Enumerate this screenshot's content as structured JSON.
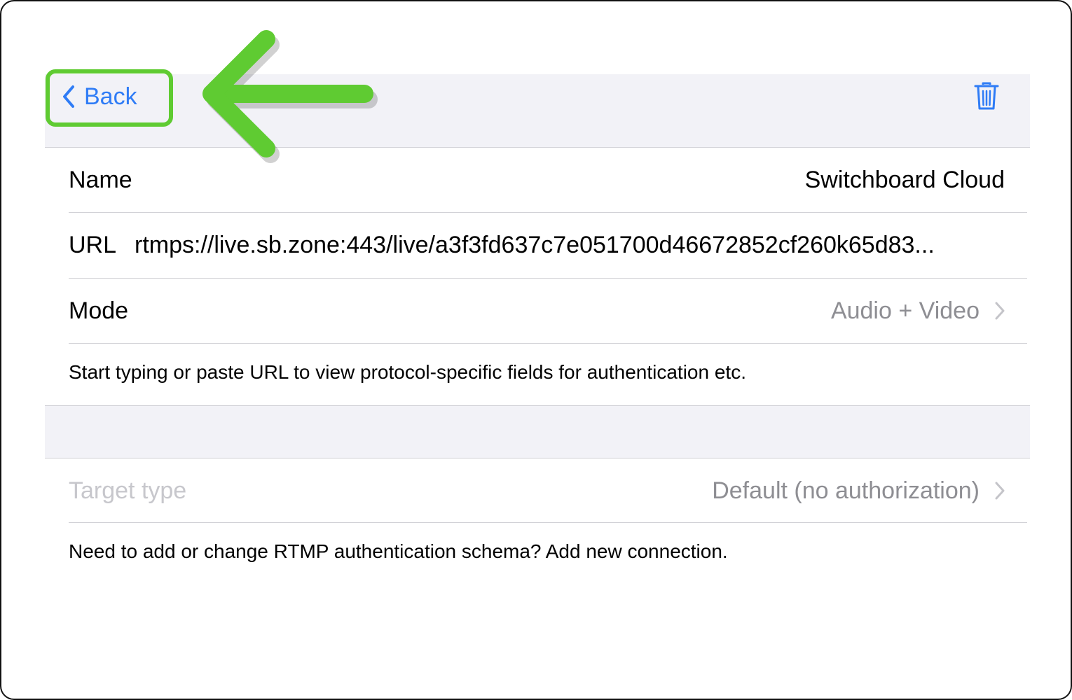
{
  "navbar": {
    "back_label": "Back",
    "back_icon": "chevron-left-icon",
    "delete_icon": "trash-icon"
  },
  "connection": {
    "name_label": "Name",
    "name_value": "Switchboard Cloud",
    "url_label": "URL",
    "url_value": "rtmps://live.sb.zone:443/live/a3f3fd637c7e051700d46672852cf260k65d83...",
    "mode_label": "Mode",
    "mode_value": "Audio + Video"
  },
  "hint_text": "Start typing or paste URL to view protocol-specific fields for authentication etc.",
  "target": {
    "label": "Target type",
    "value": "Default (no authorization)"
  },
  "footer_text": "Need to add or change RTMP authentication schema? Add new connection.",
  "colors": {
    "accent_blue": "#2f7cf6",
    "annotation_green": "#5fcb32",
    "secondary_gray": "#8e8e93",
    "grouped_background": "#f2f2f7"
  }
}
